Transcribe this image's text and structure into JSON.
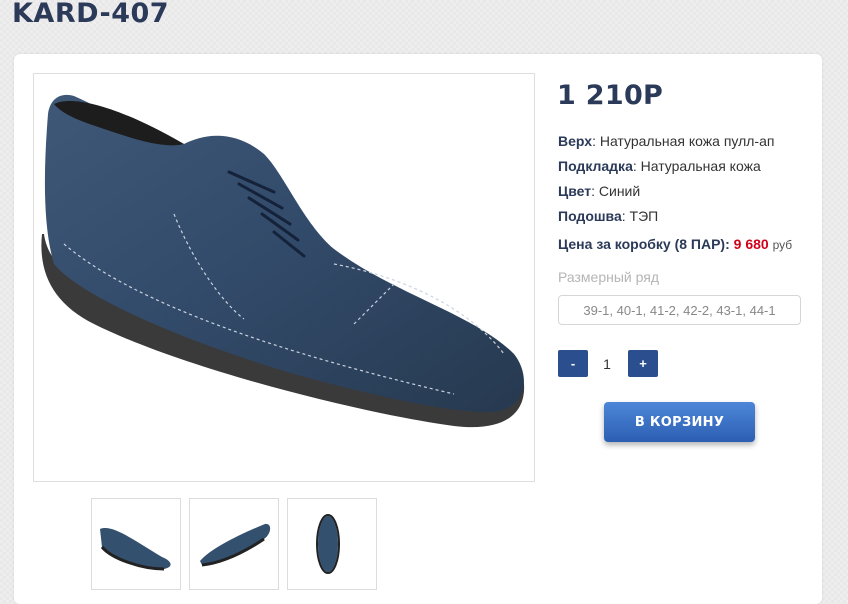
{
  "product": {
    "title": "KARD-407",
    "price": "1 210Р"
  },
  "specs": [
    {
      "label": "Верх",
      "value": ": Натуральная кожа пулл-ап"
    },
    {
      "label": "Подкладка",
      "value": ": Натуральная кожа"
    },
    {
      "label": "Цвет",
      "value": ": Синий"
    },
    {
      "label": "Подошва",
      "value": ": ТЭП"
    }
  ],
  "box_price": {
    "label": "Цена за коробку (8 ПАР):",
    "value": "9 680",
    "unit": "руб"
  },
  "sizes": {
    "label": "Размерный ряд",
    "value": "39-1, 40-1, 41-2, 42-2, 43-1, 44-1"
  },
  "quantity": {
    "minus": "-",
    "value": "1",
    "plus": "+"
  },
  "cart": {
    "label": "В КОРЗИНУ"
  },
  "colors": {
    "brand": "#2b3a58",
    "accent_blue": "#2b4f8e",
    "price_red": "#d0021b"
  }
}
